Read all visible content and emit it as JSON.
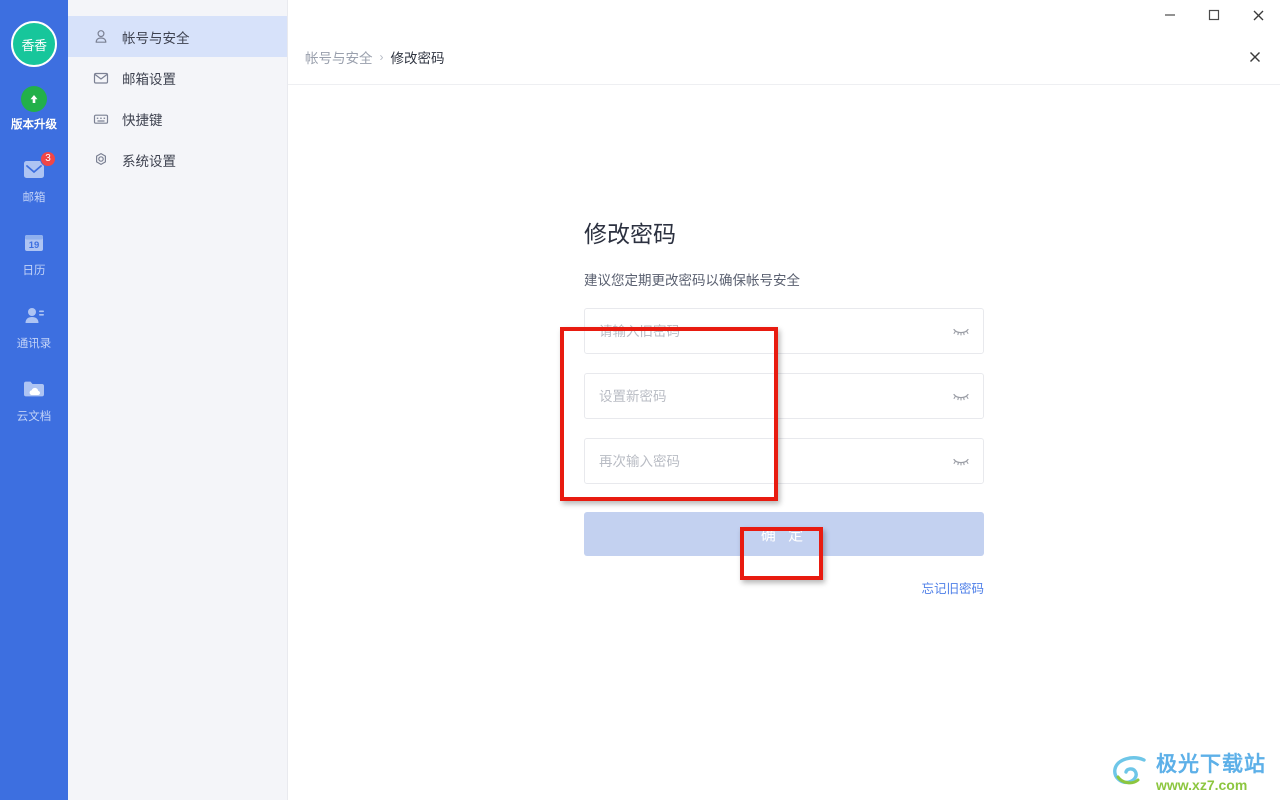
{
  "rail": {
    "avatar_text": "香香",
    "upgrade": {
      "label": "版本升级",
      "icon": "arrow-up-circle-icon"
    },
    "items": [
      {
        "label": "邮箱",
        "icon": "mail-icon",
        "badge": "3"
      },
      {
        "label": "日历",
        "icon": "calendar-icon",
        "day": "19"
      },
      {
        "label": "通讯录",
        "icon": "contacts-icon"
      },
      {
        "label": "云文档",
        "icon": "cloud-folder-icon"
      }
    ]
  },
  "settings_nav": {
    "items": [
      {
        "label": "帐号与安全",
        "icon": "person-icon",
        "active": true
      },
      {
        "label": "邮箱设置",
        "icon": "envelope-icon",
        "active": false
      },
      {
        "label": "快捷键",
        "icon": "keyboard-icon",
        "active": false
      },
      {
        "label": "系统设置",
        "icon": "gear-icon",
        "active": false
      }
    ]
  },
  "titlebar": {
    "minimize": "minimize-icon",
    "maximize": "maximize-icon",
    "close": "close-icon"
  },
  "breadcrumb": {
    "parent": "帐号与安全",
    "separator": "›",
    "current": "修改密码"
  },
  "form": {
    "title": "修改密码",
    "subtitle": "建议您定期更改密码以确保帐号安全",
    "fields": [
      {
        "name": "old-password",
        "value": "",
        "placeholder": "请输入旧密码",
        "toggle_icon": "eye-closed-icon"
      },
      {
        "name": "new-password",
        "value": "",
        "placeholder": "设置新密码",
        "toggle_icon": "eye-closed-icon"
      },
      {
        "name": "confirm-password",
        "value": "",
        "placeholder": "再次输入密码",
        "toggle_icon": "eye-closed-icon"
      }
    ],
    "submit_label": "确 定",
    "forgot_label": "忘记旧密码"
  },
  "watermark": {
    "title": "极光下载站",
    "url": "www.xz7.com"
  },
  "colors": {
    "rail_blue": "#3d6fe0",
    "avatar_green": "#17c69b",
    "upgrade_green": "#22b04a",
    "badge_red": "#f04646",
    "active_item": "#d7e2fa",
    "submit_disabled": "#c3d1f0",
    "link_blue": "#4e7fe8",
    "annotation_red": "#e81b10"
  }
}
